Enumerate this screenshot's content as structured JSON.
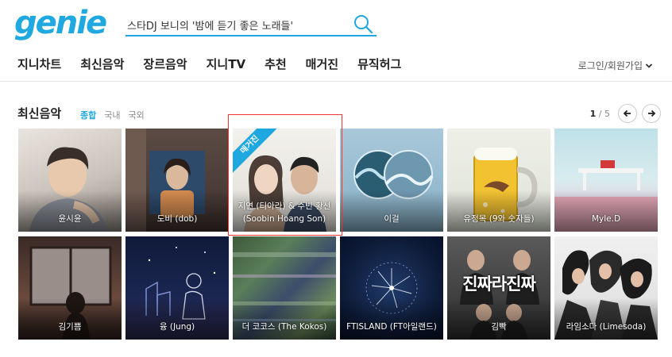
{
  "header": {
    "logo": "genie",
    "search": {
      "value": "스타DJ 보니의 '밤에 듣기 좋은 노래들'"
    },
    "nav": [
      "지니차트",
      "최신음악",
      "장르음악",
      "지니TV",
      "추천",
      "매거진",
      "뮤직허그"
    ],
    "login": "로그인/회원가입"
  },
  "section": {
    "title": "최신음악",
    "tabs": [
      "종합",
      "국내",
      "국외"
    ],
    "active_tab": "종합",
    "page_current": "1",
    "page_total": "/ 5"
  },
  "albums": [
    {
      "label": "윤시윤"
    },
    {
      "label": "도비 (dob)"
    },
    {
      "label": "지연 (티아라) & 수빈 황선 (Soobin Hoang Son)",
      "badge": "매거진"
    },
    {
      "label": "이걸"
    },
    {
      "label": "유정목 (9와 숫자들)"
    },
    {
      "label": "Myle.D"
    },
    {
      "label": "김기쁨"
    },
    {
      "label": "융 (Jung)"
    },
    {
      "label": "더 코코스 (The Kokos)"
    },
    {
      "label": "FTISLAND (FT아일랜드)"
    },
    {
      "label": "김빡",
      "art_text": "진짜라진짜"
    },
    {
      "label": "라임소다 (Limesoda)"
    }
  ],
  "colors": {
    "brand": "#20a9e1",
    "highlight": "#ee3333"
  }
}
